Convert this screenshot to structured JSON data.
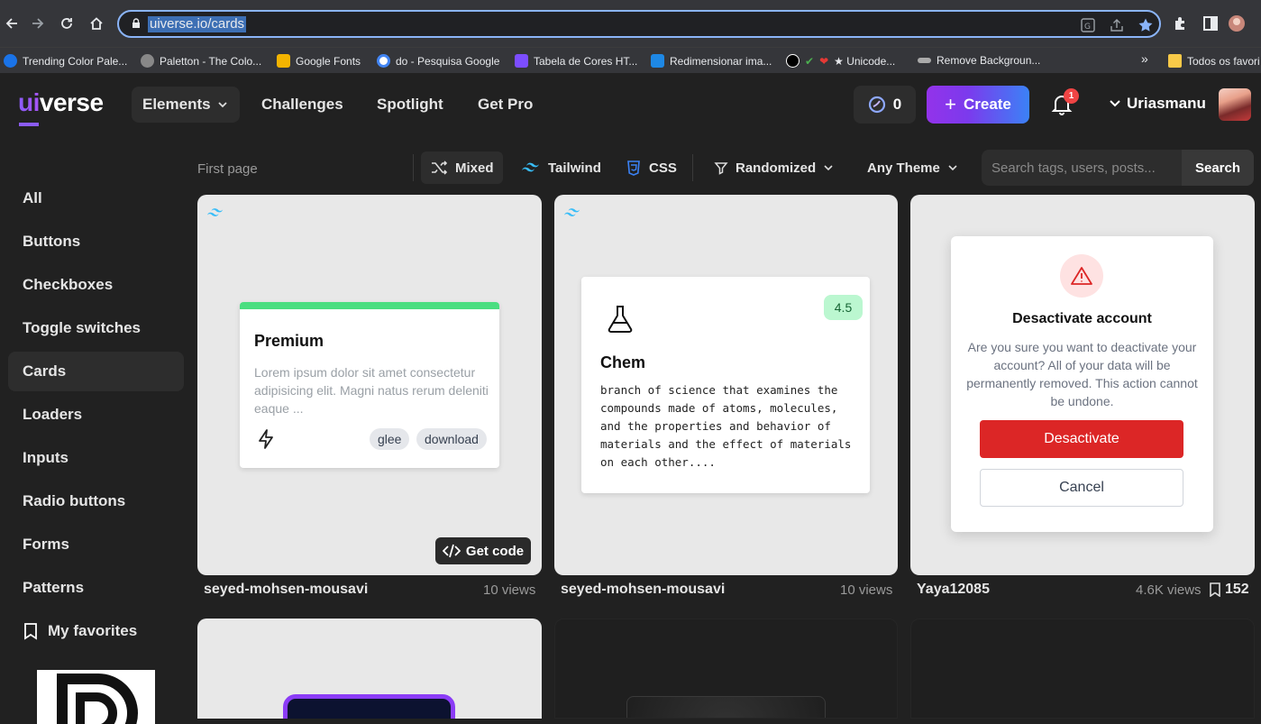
{
  "browser": {
    "url": "uiverse.io/cards",
    "bookmarks": [
      {
        "label": "Trending Color Pale...",
        "color": "#1a73e8"
      },
      {
        "label": "Paletton - The Colo...",
        "color": "#888888"
      },
      {
        "label": "Google Fonts",
        "color": "#f4b400"
      },
      {
        "label": "do - Pesquisa Google",
        "color": "#4285f4"
      },
      {
        "label": "Tabela de Cores HT...",
        "color": "#7c4dff"
      },
      {
        "label": "Redimensionar ima...",
        "color": "#1e88e5"
      },
      {
        "label": "★ Unicode...",
        "color": "#ffffff"
      },
      {
        "label": "Remove Backgroun...",
        "color": "#aaaaaa"
      }
    ],
    "bookmarks_overflow": "»",
    "all_bookmarks": "Todos os favori"
  },
  "header": {
    "logo_ui": "ui",
    "logo_verse": "verse",
    "nav": [
      "Elements",
      "Challenges",
      "Spotlight",
      "Get Pro"
    ],
    "coins": "0",
    "create_label": "Create",
    "notification_count": "1",
    "username": "Uriasmanu"
  },
  "filters": {
    "first_page": "First page",
    "mixed": "Mixed",
    "tailwind": "Tailwind",
    "css": "CSS",
    "sort": "Randomized",
    "theme": "Any Theme",
    "search_placeholder": "Search tags, users, posts...",
    "search_label": "Search"
  },
  "sidebar": {
    "items": [
      "All",
      "Buttons",
      "Checkboxes",
      "Toggle switches",
      "Cards",
      "Loaders",
      "Inputs",
      "Radio buttons",
      "Forms",
      "Patterns"
    ],
    "active": "Cards",
    "favorites": "My favorites"
  },
  "cards": [
    {
      "author": "seyed-mohsen-mousavi",
      "views": "10 views",
      "premium": {
        "title": "Premium",
        "text": "Lorem ipsum dolor sit amet consectetur adipisicing elit. Magni natus rerum deleniti eaque ...",
        "tags": [
          "glee",
          "download"
        ]
      },
      "get_code": "Get code"
    },
    {
      "author": "seyed-mohsen-mousavi",
      "views": "10 views",
      "chem": {
        "rating": "4.5",
        "title": "Chem",
        "text": "branch of science that examines the compounds made of atoms, molecules, and the properties and behavior of materials and the effect of materials on each other...."
      }
    },
    {
      "author": "Yaya12085",
      "views": "4.6K views",
      "bookmarks": "152",
      "modal": {
        "title": "Desactivate account",
        "text": "Are you sure you want to deactivate your account? All of your data will be permanently removed. This action cannot be undone.",
        "confirm": "Desactivate",
        "cancel": "Cancel"
      }
    }
  ]
}
